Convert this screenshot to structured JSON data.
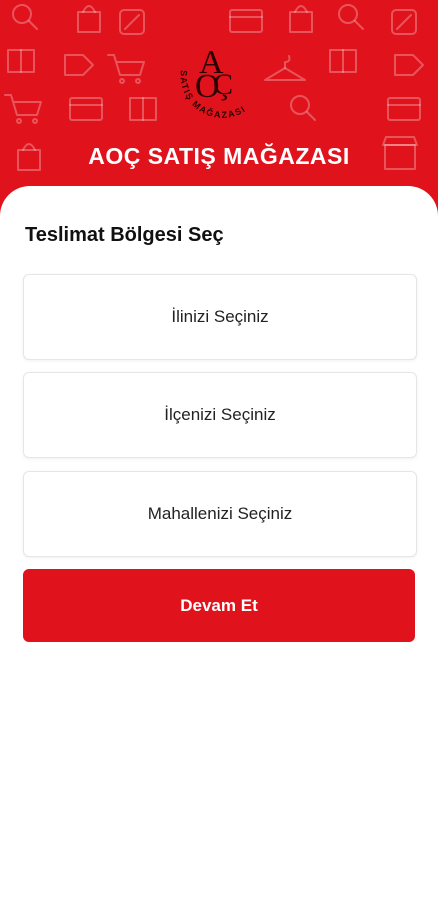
{
  "brand": {
    "name": "AOÇ SATIŞ MAĞAZASI",
    "logo_monogram": "AOÇ",
    "logo_ring_text": "SATIŞ MAĞAZASI"
  },
  "delivery": {
    "title": "Teslimat Bölgesi Seç",
    "province_placeholder": "İlinizi Seçiniz",
    "district_placeholder": "İlçenizi Seçiniz",
    "neighborhood_placeholder": "Mahallenizi Seçiniz",
    "continue_label": "Devam Et"
  },
  "colors": {
    "primary": "#e0131c",
    "background": "#ffffff",
    "text": "#111111"
  },
  "icons": [
    "search-icon",
    "shopping-bag-icon",
    "percent-tag-icon",
    "shopping-cart-icon",
    "gift-icon",
    "store-icon",
    "credit-card-icon",
    "hanger-icon",
    "price-tag-icon"
  ]
}
